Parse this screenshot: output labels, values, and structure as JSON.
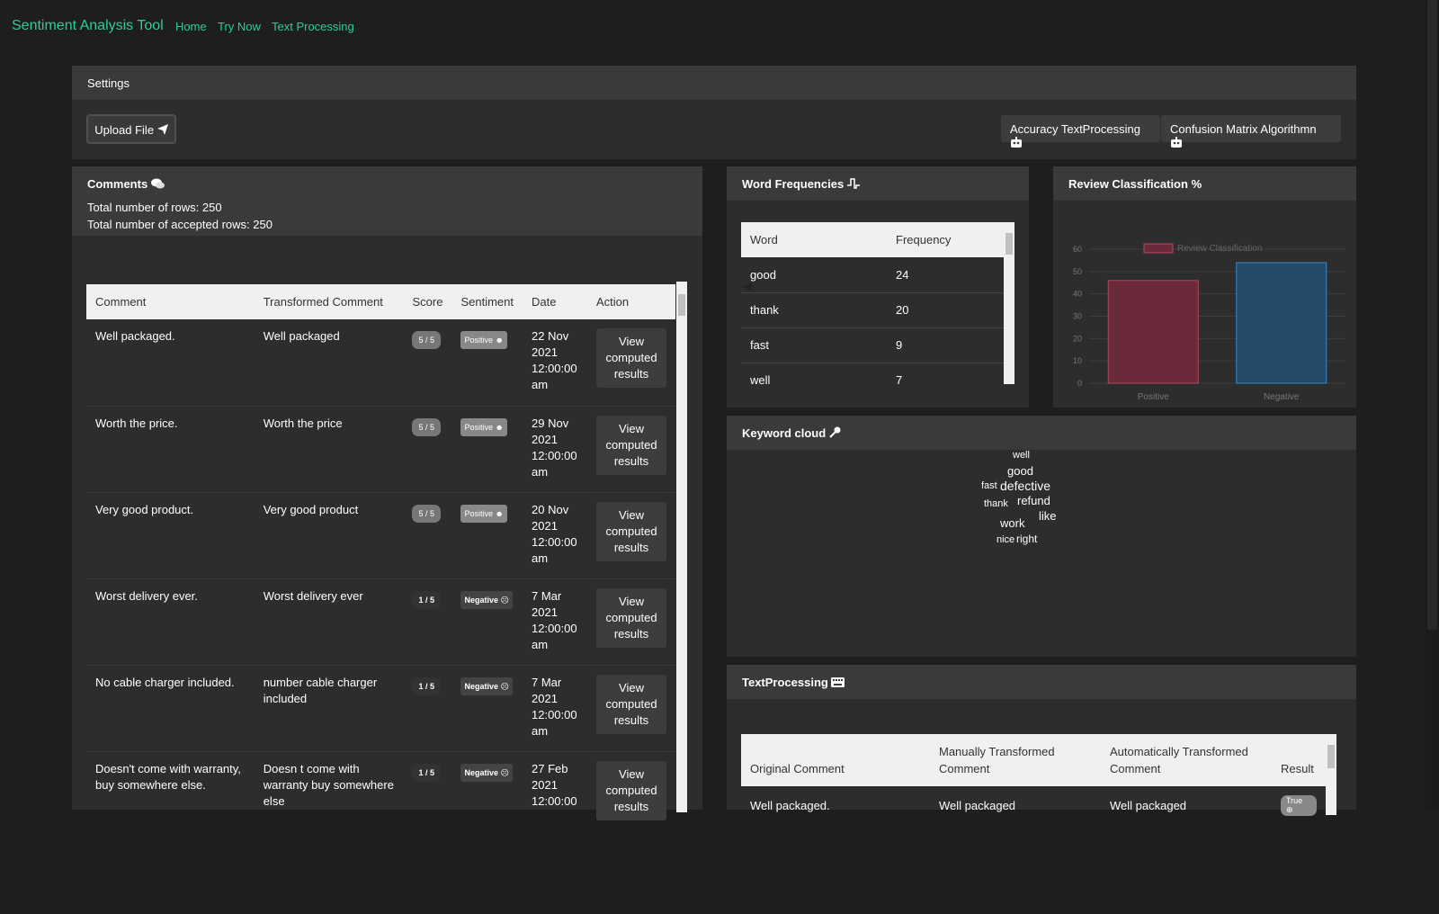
{
  "nav": {
    "brand": "Sentiment Analysis Tool",
    "links": [
      "Home",
      "Try Now",
      "Text Processing"
    ]
  },
  "settings": {
    "title": "Settings",
    "upload_label": "Upload File",
    "accuracy_label": "Accuracy TextProcessing",
    "confusion_label": "Confusion Matrix Algorithmn"
  },
  "comments": {
    "title": "Comments",
    "total_rows": "Total number of rows: 250",
    "accepted_rows": "Total number of accepted rows: 250",
    "columns": [
      "Comment",
      "Transformed Comment",
      "Score",
      "Sentiment",
      "Date",
      "Action"
    ],
    "rows": [
      {
        "comment": "Well packaged.",
        "transformed": "Well packaged",
        "score": "5 / 5",
        "sentiment": "Positive",
        "date": "22 Nov 2021 12:00:00 am",
        "action": "View computed results"
      },
      {
        "comment": "Worth the price.",
        "transformed": "Worth the price",
        "score": "5 / 5",
        "sentiment": "Positive",
        "date": "29 Nov 2021 12:00:00 am",
        "action": "View computed results"
      },
      {
        "comment": "Very good product.",
        "transformed": "Very good product",
        "score": "5 / 5",
        "sentiment": "Positive",
        "date": "20 Nov 2021 12:00:00 am",
        "action": "View computed results"
      },
      {
        "comment": "Worst delivery ever.",
        "transformed": "Worst delivery ever",
        "score": "1 / 5",
        "sentiment": "Negative",
        "date": "7 Mar 2021 12:00:00 am",
        "action": "View computed results"
      },
      {
        "comment": "No cable charger included.",
        "transformed": "number cable charger included",
        "score": "1 / 5",
        "sentiment": "Negative",
        "date": "7 Mar 2021 12:00:00 am",
        "action": "View computed results"
      },
      {
        "comment": "Doesn't come with warranty, buy somewhere else.",
        "transformed": "Doesn t come with warranty buy somewhere else",
        "score": "1 / 5",
        "sentiment": "Negative",
        "date": "27 Feb 2021 12:00:00",
        "action": "View computed results"
      }
    ]
  },
  "word_frequencies": {
    "title": "Word Frequencies",
    "columns": [
      "Word",
      "Frequency"
    ],
    "rows": [
      {
        "word": "good",
        "frequency": "24"
      },
      {
        "word": "thank",
        "frequency": "20"
      },
      {
        "word": "fast",
        "frequency": "9"
      },
      {
        "word": "well",
        "frequency": "7"
      }
    ]
  },
  "review_classification": {
    "title": "Review Classification"
  },
  "chart_data": {
    "type": "bar",
    "categories": [
      "Positive",
      "Negative"
    ],
    "series": [
      {
        "name": "Review Classification",
        "values": [
          46,
          54
        ]
      }
    ],
    "ylim": [
      0,
      60
    ],
    "yticks": [
      0,
      10,
      20,
      30,
      40,
      50,
      60
    ],
    "colors": {
      "Positive": "#6b2a3a",
      "Negative": "#234a66"
    },
    "border_colors": {
      "Positive": "#b04a60",
      "Negative": "#3a86c8"
    },
    "legend_position": "top",
    "grid": true
  },
  "keyword_cloud": {
    "title": "Keyword cloud",
    "words": [
      "well",
      "good",
      "fast",
      "defective",
      "thank",
      "refund",
      "like",
      "work",
      "nice",
      "right"
    ]
  },
  "text_processing": {
    "title": "TextProcessing",
    "columns": [
      "Original Comment",
      "Manually Transformed Comment",
      "Automatically Transformed Comment",
      "Result"
    ],
    "rows": [
      {
        "original": "Well packaged.",
        "manual": "Well packaged",
        "automatic": "Well packaged",
        "result": "True"
      }
    ]
  }
}
